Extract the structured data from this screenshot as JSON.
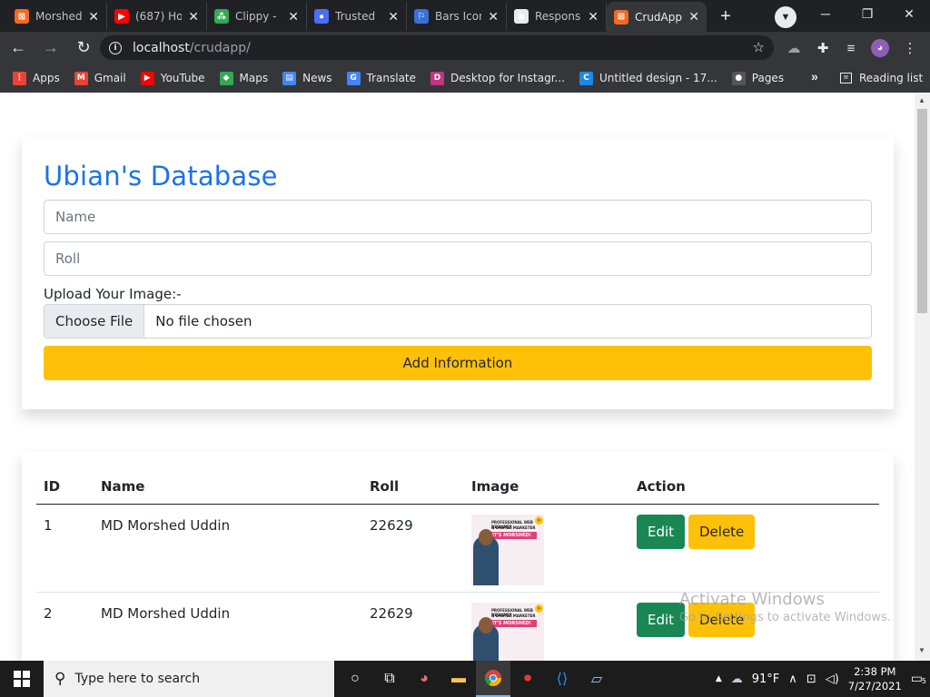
{
  "browser": {
    "tabs": [
      {
        "title": "Morshed",
        "fav_color": "#f46a23",
        "fav_glyph": "⊠"
      },
      {
        "title": "(687) Ho",
        "fav_color": "#ff0000",
        "fav_glyph": "▶"
      },
      {
        "title": "Clippy -",
        "fav_color": "#34a853",
        "fav_glyph": "⁂"
      },
      {
        "title": "Trusted",
        "fav_color": "#4c6ef5",
        "fav_glyph": "●"
      },
      {
        "title": "Bars Icon",
        "fav_color": "#3b6fd6",
        "fav_glyph": "⚐"
      },
      {
        "title": "Respons",
        "fav_color": "#e8eaed",
        "fav_glyph": "◉"
      },
      {
        "title": "CrudApp",
        "fav_color": "#f46a23",
        "fav_glyph": "⊠"
      }
    ],
    "active_tab_index": 6,
    "url_host": "localhost",
    "url_path": "/crudapp/",
    "bookmarks": [
      {
        "label": "Apps",
        "color": "#ea4335",
        "glyph": "⋮"
      },
      {
        "label": "Gmail",
        "color": "#ea4335",
        "glyph": "M"
      },
      {
        "label": "YouTube",
        "color": "#ff0000",
        "glyph": "▶"
      },
      {
        "label": "Maps",
        "color": "#34a853",
        "glyph": "◆"
      },
      {
        "label": "News",
        "color": "#4285f4",
        "glyph": "▤"
      },
      {
        "label": "Translate",
        "color": "#4285f4",
        "glyph": "G"
      },
      {
        "label": "Desktop for Instagr...",
        "color": "#c13584",
        "glyph": "D"
      },
      {
        "label": "Untitled design - 17...",
        "color": "#1e88e5",
        "glyph": "C"
      },
      {
        "label": "Pages",
        "color": "#555555",
        "glyph": "●"
      }
    ],
    "more_label": "»",
    "reading_list": "Reading list"
  },
  "form": {
    "title": "Ubian's Database",
    "name_placeholder": "Name",
    "roll_placeholder": "Roll",
    "upload_label": "Upload Your Image:-",
    "choose_file": "Choose File",
    "no_file": "No file chosen",
    "submit_label": "Add Information"
  },
  "table": {
    "headers": [
      "ID",
      "Name",
      "Roll",
      "Image",
      "Action"
    ],
    "rows": [
      {
        "id": "1",
        "name": "MD Morshed Uddin",
        "roll": "22629",
        "edit": "Edit",
        "delete": "Delete"
      },
      {
        "id": "2",
        "name": "MD Morshed Uddin",
        "roll": "22629",
        "edit": "Edit",
        "delete": "Delete"
      }
    ],
    "thumb_text": {
      "line1": "PROFESSIONAL WEB DESIGNER",
      "line2": "& DIGITAL MARKETER",
      "line3": "IT'S MORSHED!"
    }
  },
  "watermark": {
    "line1": "Activate Windows",
    "line2": "Go to Settings to activate Windows."
  },
  "taskbar": {
    "search_placeholder": "Type here to search",
    "weather": "91°F",
    "time": "2:38 PM",
    "date": "7/27/2021",
    "notifications": "5"
  }
}
